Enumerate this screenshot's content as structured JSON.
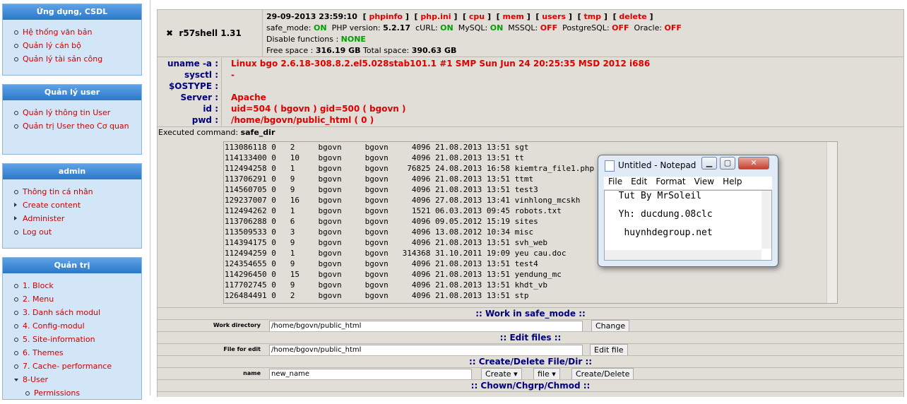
{
  "sidebar": {
    "blocks": [
      {
        "title": "Ứng dụng, CSDL",
        "items": [
          "Hệ thống văn bản",
          "Quản lý cán bộ",
          "Quản lý tài sản công"
        ]
      },
      {
        "title": "Quản lý user",
        "items": [
          "Quản lý thông tin User",
          "Quản trị User theo Cơ quan"
        ]
      },
      {
        "title": "admin",
        "items": [
          "Thông tin cá nhân",
          "Create content",
          "Administer",
          "Log out"
        ]
      },
      {
        "title": "Quản trị",
        "items": [
          "1. Block",
          "2. Menu",
          "3. Danh sách modul",
          "4. Config-modul",
          "5. Site-information",
          "6. Themes",
          "7. Cache- performance",
          "8-User",
          "Permissions"
        ]
      }
    ]
  },
  "shell": {
    "title": "r57shell 1.31",
    "datetime": "29-09-2013 23:59:10",
    "links": [
      "phpinfo",
      "php.ini",
      "cpu",
      "mem",
      "users",
      "tmp",
      "delete"
    ],
    "safe_mode_label": "safe_mode:",
    "safe_mode": "ON",
    "php_label": "PHP version:",
    "php_version": "5.2.17",
    "curl_label": "cURL:",
    "curl": "ON",
    "mysql_label": "MySQL:",
    "mysql": "ON",
    "mssql_label": "MSSQL:",
    "mssql": "OFF",
    "pgsql_label": "PostgreSQL:",
    "pgsql": "OFF",
    "oracle_label": "Oracle:",
    "oracle": "OFF",
    "disable_label": "Disable functions :",
    "disable": "NONE",
    "free_label": "Free space :",
    "free": "316.19 GB",
    "total_label": "Total space:",
    "total": "390.63 GB"
  },
  "info": {
    "labels": [
      "uname -a :",
      "sysctl :",
      "$OSTYPE :",
      "Server :",
      "id :",
      "pwd :"
    ],
    "values": [
      "Linux bgo 2.6.18-308.8.2.el5.028stab101.1 #1 SMP Sun Jun 24 20:25:35 MSD 2012 i686",
      "-",
      "",
      "Apache",
      "uid=504 ( bgovn ) gid=500 ( bgovn )",
      "/home/bgovn/public_html   ( 0 )"
    ]
  },
  "exec": {
    "label": "Executed command:",
    "command": "safe_dir"
  },
  "listing": [
    "113086118 0   2     bgovn     bgovn     4096 21.08.2013 13:51 sgt",
    "114133400 0   10    bgovn     bgovn     4096 21.08.2013 13:51 tt",
    "112494258 0   1     bgovn     bgovn    76825 24.08.2013 16:58 kiemtra_file1.php",
    "113706291 0   9     bgovn     bgovn     4096 21.08.2013 13:51 ttmt",
    "114560705 0   9     bgovn     bgovn     4096 21.08.2013 13:51 test3",
    "129237007 0   16    bgovn     bgovn     4096 27.08.2013 13:41 vinhlong_mcskh",
    "112494262 0   1     bgovn     bgovn     1521 06.03.2013 09:45 robots.txt",
    "113706288 0   6     bgovn     bgovn     4096 09.05.2012 15:19 sites",
    "113509533 0   3     bgovn     bgovn     4096 13.08.2012 10:34 misc",
    "114394175 0   9     bgovn     bgovn     4096 21.08.2013 13:51 svh_web",
    "112494259 0   1     bgovn     bgovn   314368 31.10.2011 19:09 yeu cau.doc",
    "124354655 0   9     bgovn     bgovn     4096 21.08.2013 13:51 test4",
    "114296450 0   15    bgovn     bgovn     4096 21.08.2013 13:51 yendung_mc",
    "117702745 0   9     bgovn     bgovn     4096 21.08.2013 13:51 khdt_vb",
    "126484491 0   2     bgovn     bgovn     4096 21.08.2013 13:51 stp"
  ],
  "forms": {
    "safe_mode_title": ":: Work in safe_mode ::",
    "workdir_label": "Work directory",
    "workdir_value": "/home/bgovn/public_html",
    "change_btn": "Change",
    "edit_title": ":: Edit files ::",
    "file_label": "File for edit",
    "file_value": "/home/bgovn/public_html",
    "edit_btn": "Edit file",
    "create_title": ":: Create/Delete File/Dir ::",
    "name_label": "name",
    "name_value": "new_name",
    "create_select": "Create",
    "type_select": "file",
    "create_btn": "Create/Delete",
    "chown_title": ":: Chown/Chgrp/Chmod ::"
  },
  "notepad": {
    "title": "Untitled - Notepad",
    "menu": [
      "File",
      "Edit",
      "Format",
      "View",
      "Help"
    ],
    "lines": [
      "  Tut By MrSoleil",
      "  Yh: ducdung.08clc",
      "   huynhdegroup.net"
    ]
  },
  "colors": {
    "sidebar_header": "#2b78c8",
    "sidebar_bg": "#d3e6f7",
    "panel_bg": "#e1ded8",
    "link_red": "#e00000",
    "on_green": "#00a000",
    "label_navy": "#000080"
  }
}
